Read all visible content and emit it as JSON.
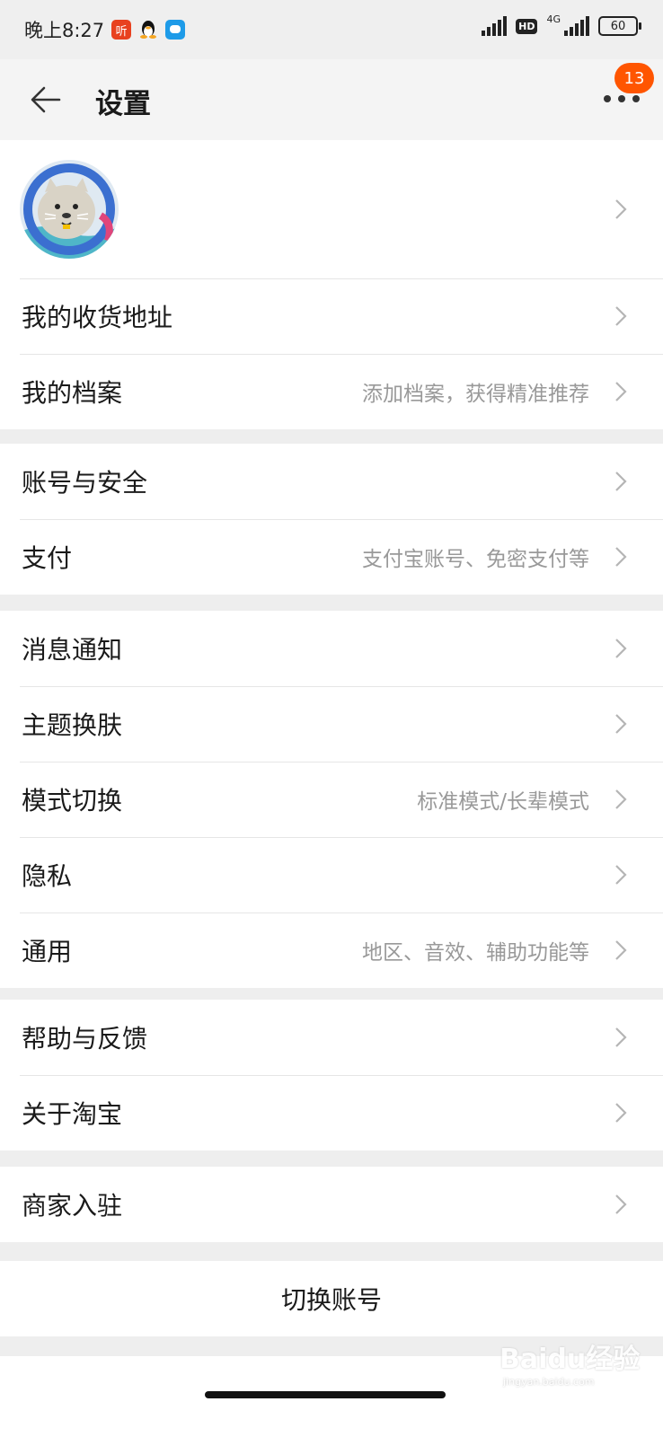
{
  "status_bar": {
    "time": "晚上8:27",
    "app_icons": [
      "ting-icon",
      "qq-icon",
      "message-icon"
    ],
    "ting_label": "听",
    "hd_label": "HD",
    "network_label": "4G",
    "battery_level": "60"
  },
  "header": {
    "title": "设置",
    "notification_count": "13"
  },
  "groups": [
    {
      "rows": [
        {
          "label": "我的收货地址",
          "hint": ""
        },
        {
          "label": "我的档案",
          "hint": "添加档案，获得精准推荐"
        }
      ]
    },
    {
      "rows": [
        {
          "label": "账号与安全",
          "hint": ""
        },
        {
          "label": "支付",
          "hint": "支付宝账号、免密支付等"
        }
      ]
    },
    {
      "rows": [
        {
          "label": "消息通知",
          "hint": ""
        },
        {
          "label": "主题换肤",
          "hint": ""
        },
        {
          "label": "模式切换",
          "hint": "标准模式/长辈模式"
        },
        {
          "label": "隐私",
          "hint": ""
        },
        {
          "label": "通用",
          "hint": "地区、音效、辅助功能等"
        }
      ]
    },
    {
      "rows": [
        {
          "label": "帮助与反馈",
          "hint": ""
        },
        {
          "label": "关于淘宝",
          "hint": ""
        }
      ]
    },
    {
      "rows": [
        {
          "label": "商家入驻",
          "hint": ""
        }
      ]
    }
  ],
  "switch_account": "切换账号",
  "watermark": {
    "brand": "Baidu经验",
    "url": "jingyan.baidu.com"
  }
}
